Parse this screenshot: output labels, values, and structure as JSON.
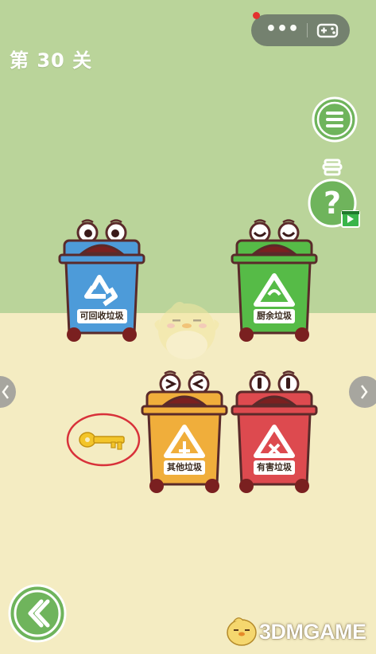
{
  "level": {
    "title": "第 30 关"
  },
  "topbar": {
    "more": "•••",
    "notify": true
  },
  "bins": [
    {
      "label": "可回收垃圾",
      "color": "#4d9bd9"
    },
    {
      "label": "厨余垃圾",
      "color": "#56bb47"
    },
    {
      "label": "其他垃圾",
      "color": "#f0ae3b"
    },
    {
      "label": "有害垃圾",
      "color": "#dd4a4f"
    }
  ],
  "colors": {
    "bg_top": "#bad49a",
    "bg_bottom": "#f4ecc2",
    "key": "#f3c52a",
    "circle": "#d8313a"
  },
  "watermark": {
    "text": "3DMGAME"
  },
  "icons": [
    "more-icon",
    "gamepad-icon",
    "menu-icon",
    "hint-icon",
    "video-icon",
    "key-icon",
    "back-icon"
  ]
}
